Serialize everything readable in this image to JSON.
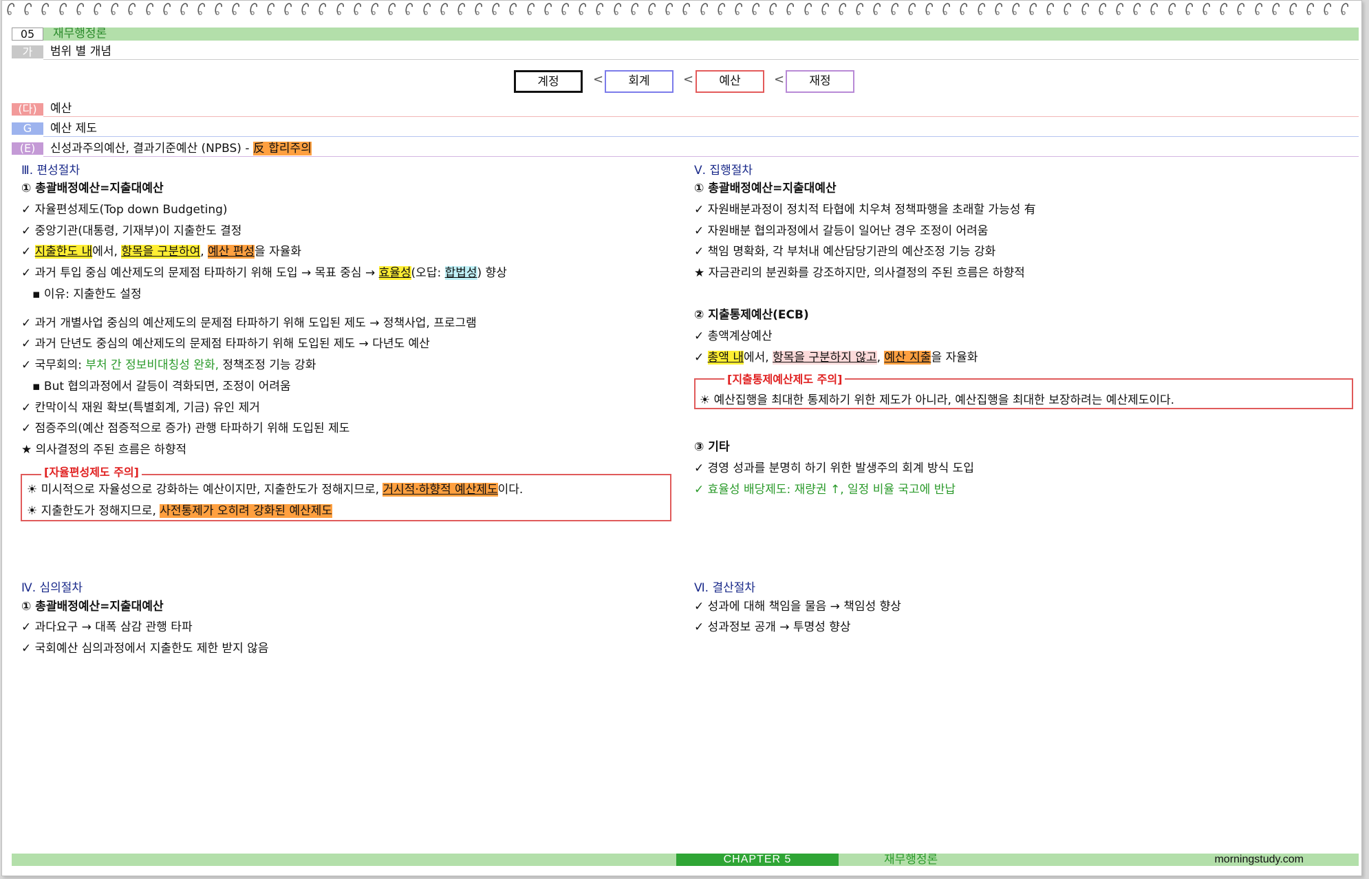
{
  "header": {
    "chapter_num": "05",
    "chapter_title": "재무행정론",
    "sub_tag": "가",
    "sub_title": "범위 별 개념"
  },
  "chain": {
    "items": [
      "계정",
      "회계",
      "예산",
      "재정"
    ],
    "sep": "<"
  },
  "rows": {
    "da_tag": "(다)",
    "da_label": "예산",
    "g_tag": "G",
    "g_label": "예산 제도",
    "e_tag": "(E)",
    "e_label": "신성과주의예산, 결과기준예산 (NPBS)  -",
    "e_highlight": "反 합리주의"
  },
  "left": {
    "s3_title": "Ⅲ. 편성절차",
    "s3_h1": "① 총괄배정예산=지출대예산",
    "s3_l1": "✓ 자율편성제도(Top down Budgeting)",
    "s3_l2": "✓ 중앙기관(대통령, 기재부)이 지출한도 결정",
    "s3_l3_a": "✓ ",
    "s3_l3_h1": "지출한도 내",
    "s3_l3_b": "에서, ",
    "s3_l3_h2": "항목을 구분하여",
    "s3_l3_c": ", ",
    "s3_l3_h3": "예산 편성",
    "s3_l3_d": "을 자율화",
    "s3_l4_a": "✓ 과거 투입 중심 예산제도의 문제점 타파하기 위해 도입 → 목표 중심 → ",
    "s3_l4_h1": "효율성",
    "s3_l4_b": "(오답: ",
    "s3_l4_h2": "합법성",
    "s3_l4_c": ") 향상",
    "s3_l5": "▪ 이유: 지출한도 설정",
    "s3_l6": "✓ 과거 개별사업 중심의 예산제도의 문제점 타파하기 위해 도입된 제도 → 정책사업, 프로그램",
    "s3_l7": "✓ 과거 단년도 중심의 예산제도의 문제점 타파하기 위해 도입된 제도 → 다년도 예산",
    "s3_l8_a": "✓ 국무회의: ",
    "s3_l8_g": "부처 간 정보비대칭성 완화,",
    "s3_l8_b": " 정책조정 기능 강화",
    "s3_l9": "▪ But 협의과정에서 갈등이 격화되면, 조정이 어려움",
    "s3_l10": "✓ 칸막이식 재원 확보(특별회계, 기금) 유인 제거",
    "s3_l11": "✓ 점증주의(예산 점증적으로 증가) 관행 타파하기 위해 도입된 제도",
    "s3_l12": "★ 의사결정의 주된 흐름은 하향적",
    "note1_title": "[자율편성제도 주의]",
    "note1_l1_a": "☀ 미시적으로 자율성으로 강화하는 예산이지만, 지출한도가 정해지므로, ",
    "note1_l1_h": "거시적·하향적 예산제도",
    "note1_l1_b": "이다.",
    "note1_l2_a": "☀ 지출한도가 정해지므로, ",
    "note1_l2_h": "사전통제가 오히려 강화된 예산제도",
    "s4_title": "Ⅳ. 심의절차",
    "s4_h1": "① 총괄배정예산=지출대예산",
    "s4_l1": "✓ 과다요구 → 대폭 삼감 관행 타파",
    "s4_l2": "✓ 국회예산 심의과정에서 지출한도 제한 받지 않음"
  },
  "right": {
    "s5_title": "Ⅴ. 집행절차",
    "s5_h1": "① 총괄배정예산=지출대예산",
    "s5_l1": "✓ 자원배분과정이 정치적 타협에 치우쳐 정책파행을 초래할 가능성 有",
    "s5_l2": "✓ 자원배분 협의과정에서 갈등이 일어난 경우 조정이 어려움",
    "s5_l3": "✓ 책임 명확화, 각 부처내 예산담당기관의 예산조정 기능 강화",
    "s5_l4": "★ 자금관리의 분권화를 강조하지만, 의사결정의 주된 흐름은 하향적",
    "s5_h2": "② 지출통제예산(ECB)",
    "s5_l5": "✓ 총액계상예산",
    "s5_l6_a": "✓ ",
    "s5_l6_h1": "총액 내",
    "s5_l6_b": "에서, ",
    "s5_l6_h2": "항목을 구분하지 않고",
    "s5_l6_c": ", ",
    "s5_l6_h3": "예산 지출",
    "s5_l6_d": "을 자율화",
    "note2_title": "[지출통제예산제도 주의]",
    "note2_l1": "☀ 예산집행을 최대한 통제하기 위한 제도가 아니라, 예산집행을 최대한 보장하려는 예산제도이다.",
    "s5_h3": "③ 기타",
    "s5_l7": "✓ 경영 성과를 분명히 하기 위한 발생주의 회계 방식 도입",
    "s5_l8": "✓ 효율성 배당제도: 재량권 ↑, 일정 비율 국고에 반납",
    "s6_title": "Ⅵ. 결산절차",
    "s6_l1": "✓ 성과에 대해 책임을 물음 →  책임성 향상",
    "s6_l2": "✓ 성과정보 공개 → 투명성 향상"
  },
  "footer": {
    "chapter": "CHAPTER 5",
    "label": "재무행정론",
    "site": "morningstudy.com"
  },
  "colors": {
    "green_bar": "#b3dfaa",
    "pink_tag": "#f29a9a",
    "blue_tag": "#9db3ee",
    "purple_tag": "#c49ad6",
    "box_blue": "#7b7bea",
    "box_red": "#e35a5a",
    "box_purple": "#b889d6"
  }
}
